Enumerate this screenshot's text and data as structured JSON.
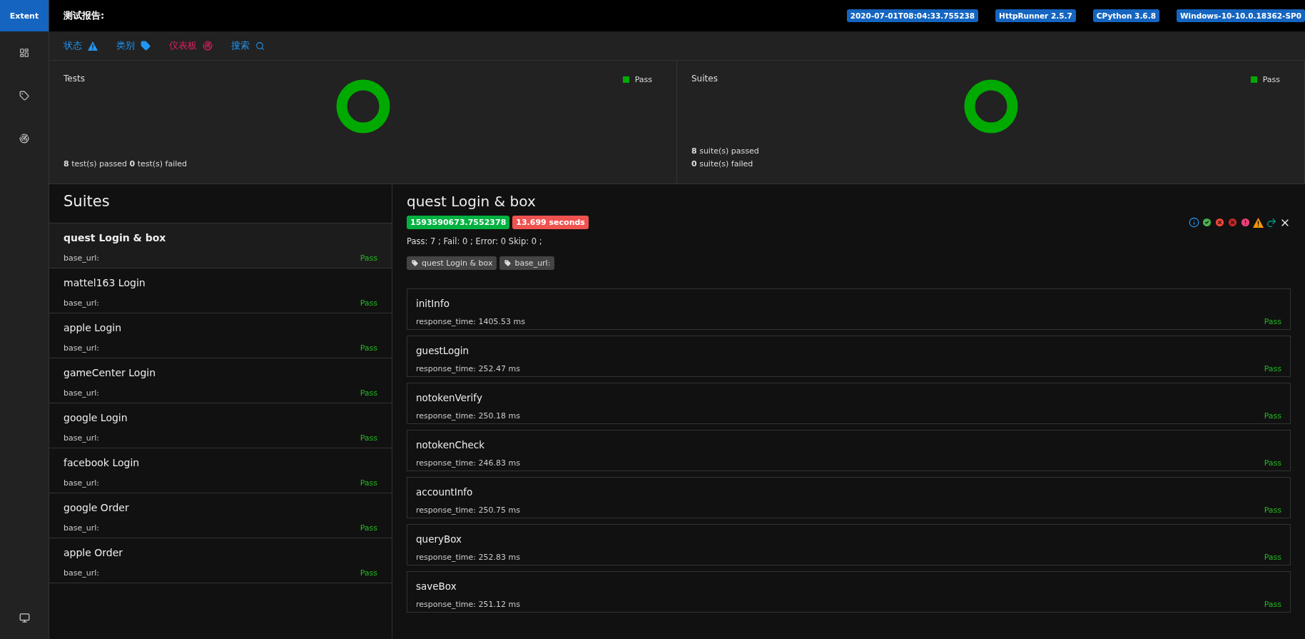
{
  "brand": "Extent",
  "report_title": "测试报告:",
  "env_badges": [
    "2020-07-01T08:04:33.755238",
    "HttpRunner 2.5.7",
    "CPython 3.6.8",
    "Windows-10-10.0.18362-SP0"
  ],
  "nav": [
    {
      "label": "状态",
      "kind": "status",
      "selected": false
    },
    {
      "label": "类别",
      "kind": "category",
      "selected": false
    },
    {
      "label": "仪表板",
      "kind": "dashboard",
      "selected": true
    },
    {
      "label": "搜索",
      "kind": "search",
      "selected": false
    }
  ],
  "summary": [
    {
      "title": "Tests",
      "legend": "Pass",
      "lines": [
        "**8** test(s) passed **0** test(s) failed"
      ]
    },
    {
      "title": "Suites",
      "legend": "Pass",
      "lines": [
        "**8** suite(s) passed",
        "**0** suite(s) failed"
      ]
    }
  ],
  "suites": {
    "heading": "Suites",
    "items": [
      {
        "name": "quest Login & box",
        "detail": "base_url:",
        "status": "Pass",
        "selected": true
      },
      {
        "name": "mattel163 Login",
        "detail": "base_url:",
        "status": "Pass",
        "selected": false
      },
      {
        "name": "apple Login",
        "detail": "base_url:",
        "status": "Pass",
        "selected": false
      },
      {
        "name": "gameCenter Login",
        "detail": "base_url:",
        "status": "Pass",
        "selected": false
      },
      {
        "name": "google Login",
        "detail": "base_url:",
        "status": "Pass",
        "selected": false
      },
      {
        "name": "facebook Login",
        "detail": "base_url:",
        "status": "Pass",
        "selected": false
      },
      {
        "name": "google Order",
        "detail": "base_url:",
        "status": "Pass",
        "selected": false
      },
      {
        "name": "apple Order",
        "detail": "base_url:",
        "status": "Pass",
        "selected": false
      }
    ]
  },
  "detail": {
    "title": "quest Login & box",
    "start": "1593590673.7552378",
    "duration": "13.699 seconds",
    "counts": "Pass: 7 ; Fail: 0 ; Error: 0 Skip: 0 ;",
    "tags": [
      "quest Login & box",
      "base_url:"
    ],
    "tests": [
      {
        "name": "initInfo",
        "detail": "response_time: 1405.53 ms",
        "status": "Pass"
      },
      {
        "name": "guestLogin",
        "detail": "response_time: 252.47 ms",
        "status": "Pass"
      },
      {
        "name": "notokenVerify",
        "detail": "response_time: 250.18 ms",
        "status": "Pass"
      },
      {
        "name": "notokenCheck",
        "detail": "response_time: 246.83 ms",
        "status": "Pass"
      },
      {
        "name": "accountInfo",
        "detail": "response_time: 250.75 ms",
        "status": "Pass"
      },
      {
        "name": "queryBox",
        "detail": "response_time: 252.83 ms",
        "status": "Pass"
      },
      {
        "name": "saveBox",
        "detail": "response_time: 251.12 ms",
        "status": "Pass"
      }
    ]
  }
}
